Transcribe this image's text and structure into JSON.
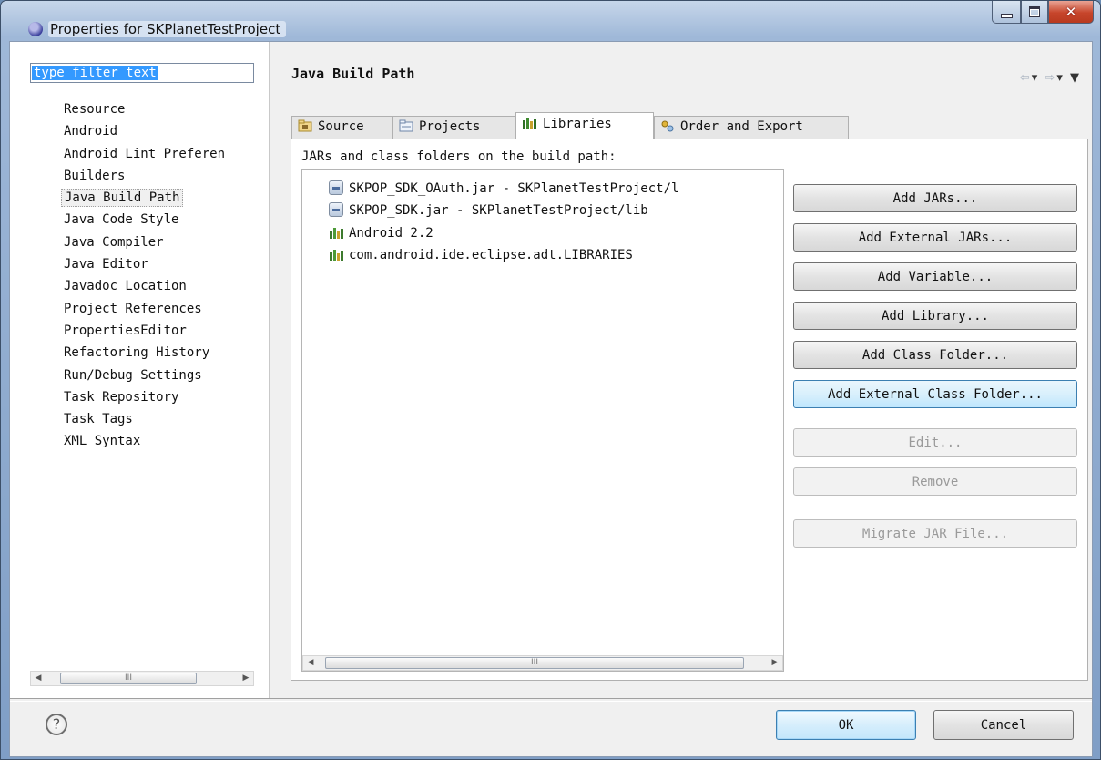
{
  "window": {
    "title": "Properties for SKPlanetTestProject"
  },
  "left": {
    "filter": {
      "text": "type filter text"
    },
    "nav_items": [
      "Resource",
      "Android",
      "Android Lint Preferen",
      "Builders",
      "Java Build Path",
      "Java Code Style",
      "Java Compiler",
      "Java Editor",
      "Javadoc Location",
      "Project References",
      "PropertiesEditor",
      "Refactoring History",
      "Run/Debug Settings",
      "Task Repository",
      "Task Tags",
      "XML Syntax"
    ],
    "selected": "Java Build Path",
    "scroll_thumb": "III"
  },
  "right": {
    "title": "Java Build Path",
    "tabs": [
      {
        "label": "Source",
        "icon": "source-folder-icon"
      },
      {
        "label": "Projects",
        "icon": "projects-icon"
      },
      {
        "label": "Libraries",
        "icon": "libraries-icon",
        "active": true
      },
      {
        "label": "Order and Export",
        "icon": "order-export-icon"
      }
    ],
    "panel_label": "JARs and class folders on the build path:",
    "entries": [
      {
        "label": "SKPOP_SDK_OAuth.jar - SKPlanetTestProject/l",
        "icon": "jar-icon"
      },
      {
        "label": "SKPOP_SDK.jar - SKPlanetTestProject/lib",
        "icon": "jar-icon"
      },
      {
        "label": "Android 2.2",
        "icon": "library-icon"
      },
      {
        "label": "com.android.ide.eclipse.adt.LIBRARIES",
        "icon": "library-icon"
      }
    ],
    "list_scroll_thumb": "III",
    "buttons": {
      "add_jars": "Add JARs...",
      "add_external_jars": "Add External JARs...",
      "add_variable": "Add Variable...",
      "add_library": "Add Library...",
      "add_class_folder": "Add Class Folder...",
      "add_external_class_folder": "Add External Class Folder...",
      "edit": "Edit...",
      "remove": "Remove",
      "migrate": "Migrate JAR File..."
    }
  },
  "footer": {
    "ok": "OK",
    "cancel": "Cancel",
    "help": "?"
  },
  "colors": {
    "selection": "#3399ff",
    "titlebar": "#9fb8d8",
    "close": "#c7452b"
  }
}
